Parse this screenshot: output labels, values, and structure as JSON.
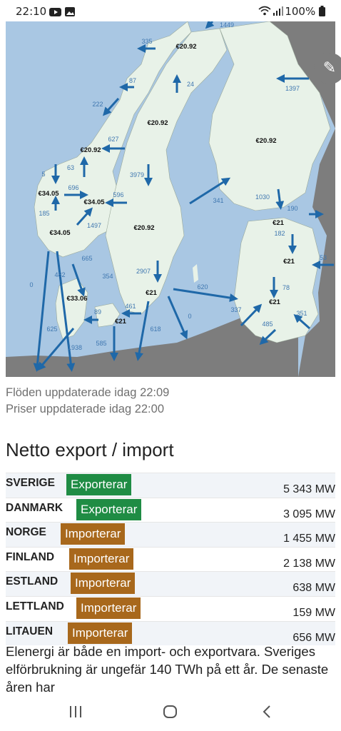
{
  "status_bar": {
    "time": "22:10",
    "battery": "100%"
  },
  "map": {
    "prices": [
      "€20.92",
      "€20.92",
      "€20.92",
      "€20.92",
      "€34.05",
      "€34.05",
      "€34.05",
      "€20.92",
      "€33.06",
      "€21",
      "€21",
      "€21",
      "€21",
      "€21"
    ],
    "flows": [
      "1449",
      "335",
      "87",
      "24",
      "1397",
      "222",
      "627",
      "63",
      "3979",
      "5",
      "696",
      "596",
      "185",
      "1497",
      "1030",
      "341",
      "190",
      "182",
      "665",
      "53",
      "0",
      "482",
      "354",
      "2907",
      "620",
      "78",
      "89",
      "461",
      "337",
      "0",
      "625",
      "618",
      "351",
      "1938",
      "585",
      "485"
    ]
  },
  "updates": {
    "flows": "Flöden uppdaterade idag 22:09",
    "prices": "Priser uppdaterade idag 22:00"
  },
  "section": {
    "title": "Netto export / import"
  },
  "table": [
    {
      "country": "SVERIGE",
      "status": "Exporterar",
      "type": "export",
      "mw": "5 343 MW"
    },
    {
      "country": "DANMARK",
      "status": "Exporterar",
      "type": "export",
      "mw": "3 095 MW"
    },
    {
      "country": "NORGE",
      "status": "Importerar",
      "type": "import",
      "mw": "1 455 MW"
    },
    {
      "country": "FINLAND",
      "status": "Importerar",
      "type": "import",
      "mw": "2 138 MW"
    },
    {
      "country": "ESTLAND",
      "status": "Importerar",
      "type": "import",
      "mw": "638 MW"
    },
    {
      "country": "LETTLAND",
      "status": "Importerar",
      "type": "import",
      "mw": "159 MW"
    },
    {
      "country": "LITAUEN",
      "status": "Importerar",
      "type": "import",
      "mw": "656 MW"
    }
  ],
  "paragraph": "Elenergi är både en import- och exportvara. Sveriges elförbrukning är ungefär 140 TWh på ett år. De senaste åren har",
  "colors": {
    "export": "#1f8c44",
    "import": "#a8681c",
    "land": "#e8f2e8",
    "sea": "#a9c7e3",
    "arrow": "#1f68a8"
  },
  "icons": [
    "youtube-icon",
    "gallery-icon",
    "wifi-icon",
    "signal-icon",
    "battery-icon",
    "pencil-icon",
    "recent-apps-icon",
    "home-icon",
    "back-icon"
  ]
}
